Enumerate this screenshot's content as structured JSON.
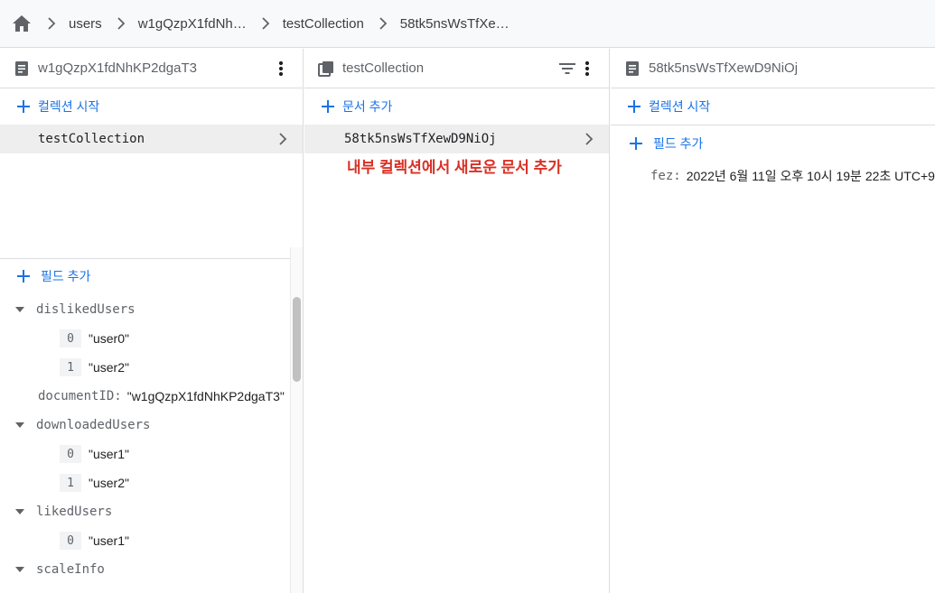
{
  "breadcrumb": {
    "items": [
      "users",
      "w1gQzpX1fdNh…",
      "testCollection",
      "58tk5nsWsTfXe…"
    ]
  },
  "panel1": {
    "title": "w1gQzpX1fdNhKP2dgaT3",
    "start_collection": "컬렉션 시작",
    "collection_item": "testCollection",
    "add_field": "필드 추가",
    "fields": {
      "disliked_key": "dislikedUsers",
      "disliked_0_idx": "0",
      "disliked_0_val": "\"user0\"",
      "disliked_1_idx": "1",
      "disliked_1_val": "\"user2\"",
      "docid_key": "documentID:",
      "docid_val": "\"w1gQzpX1fdNhKP2dgaT3\"",
      "downloaded_key": "downloadedUsers",
      "downloaded_0_idx": "0",
      "downloaded_0_val": "\"user1\"",
      "downloaded_1_idx": "1",
      "downloaded_1_val": "\"user2\"",
      "liked_key": "likedUsers",
      "liked_0_idx": "0",
      "liked_0_val": "\"user1\"",
      "scale_key": "scaleInfo"
    }
  },
  "panel2": {
    "title": "testCollection",
    "add_document": "문서 추가",
    "document_item": "58tk5nsWsTfXewD9NiOj",
    "annotation": "내부 컬렉션에서 새로운 문서 추가"
  },
  "panel3": {
    "title": "58tk5nsWsTfXewD9NiOj",
    "start_collection": "컬렉션 시작",
    "add_field": "필드 추가",
    "field_key": "fez:",
    "field_val": "2022년 6월 11일 오후 10시 19분 22초 UTC+9"
  },
  "colors": {
    "accent": "#1a73e8",
    "annotation": "#d93025",
    "selected_row": "#eeeeee"
  },
  "icons": {
    "home": "home-icon",
    "chevron": "chevron-right-icon",
    "document": "document-icon",
    "collection": "collection-icon",
    "menu": "more-vert-icon",
    "filter": "filter-icon",
    "add": "plus-icon",
    "expand": "triangle-down-icon"
  }
}
